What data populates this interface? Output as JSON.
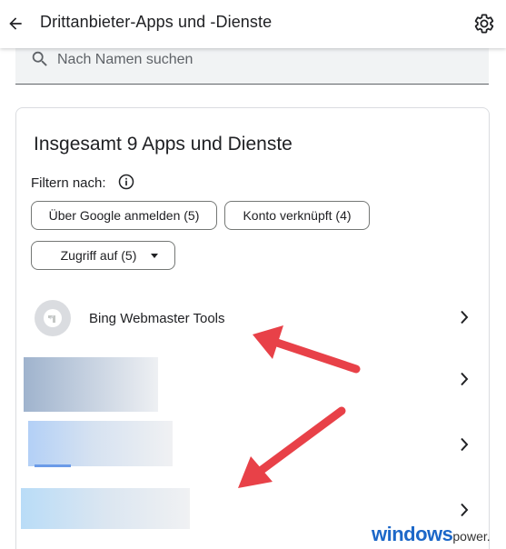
{
  "header": {
    "title": "Drittanbieter-Apps und -Dienste",
    "back_icon": "arrow-back-icon",
    "settings_icon": "gear-icon"
  },
  "search": {
    "placeholder": "Nach Namen suchen",
    "value": "",
    "icon": "search-icon"
  },
  "card": {
    "title": "Insgesamt 9 Apps und Dienste",
    "filter_label": "Filtern nach:",
    "info_icon": "info-icon",
    "filters": [
      {
        "label": "Über Google anmelden (5)"
      },
      {
        "label": "Konto verknüpft (4)"
      },
      {
        "label": "Zugriff auf (5)",
        "has_dropdown": true
      }
    ],
    "apps": [
      {
        "name": "Bing Webmaster Tools",
        "icon": "app-placeholder-icon",
        "redacted": false
      },
      {
        "name": "",
        "redacted": true
      },
      {
        "name": "",
        "redacted": true
      },
      {
        "name": "",
        "redacted": true
      }
    ]
  },
  "annotations": {
    "arrow_color": "#e84148"
  },
  "watermark": {
    "main": "windows",
    "sub": "power."
  },
  "colors": {
    "text": "#202124",
    "secondary": "#5f6368",
    "border": "#dadce0",
    "search_bg": "#f1f3f4",
    "watermark_blue": "#1c67c8"
  }
}
